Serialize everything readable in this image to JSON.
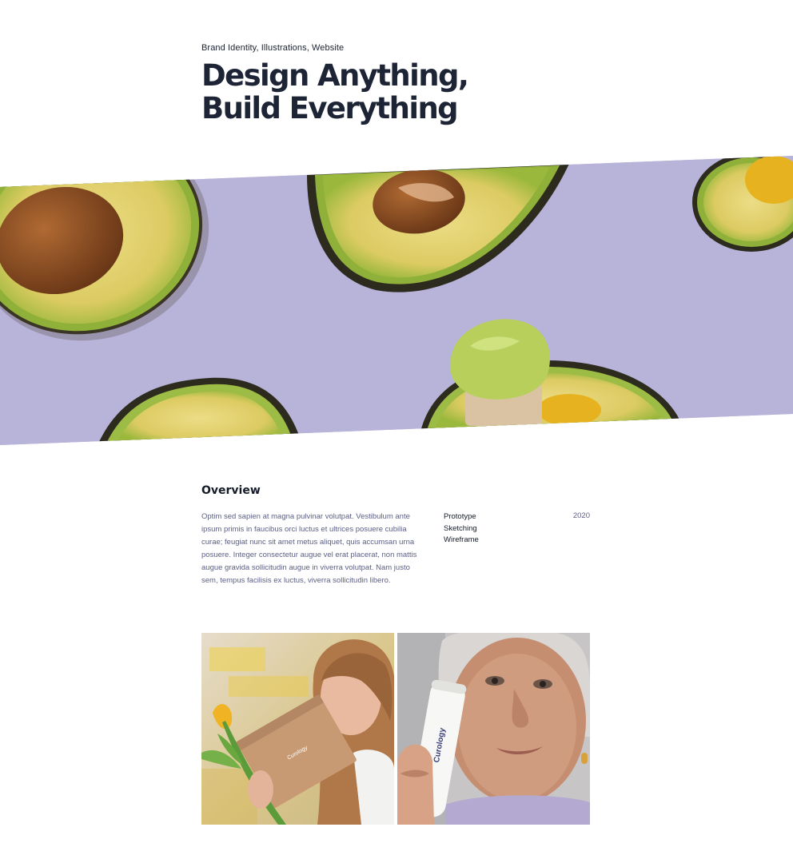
{
  "project": {
    "categories": "Brand Identity, Illustrations, Website",
    "title_line1": "Design Anything,",
    "title_line2": "Build Everything"
  },
  "overview": {
    "heading": "Overview",
    "body": "Optim sed sapien at magna pulvinar volutpat. Vestibulum ante ipsum primis in faucibus orci luctus et ultrices posuere cubilia curae; feugiat nunc sit amet metus aliquet, quis accumsan urna posuere. Integer consectetur augue vel erat placerat, non mattis augue gravida sollicitudin augue in viverra volutpat. Nam justo sem, tempus facilisis ex luctus, viverra sollicitudin libero.",
    "services": [
      "Prototype",
      "Sketching",
      "Wireframe"
    ],
    "year": "2020"
  },
  "gallery": {
    "box_brand": "Curology",
    "bottle_brand": "Curology"
  },
  "colors": {
    "banner_background": "#b8b3d9",
    "avocado_flesh": "#e6d67a",
    "avocado_rim": "#8fb13a",
    "avocado_skin": "#3a3524",
    "pit": "#8a4e25",
    "heading_text": "#1d2435",
    "body_text": "#5b5f85"
  }
}
